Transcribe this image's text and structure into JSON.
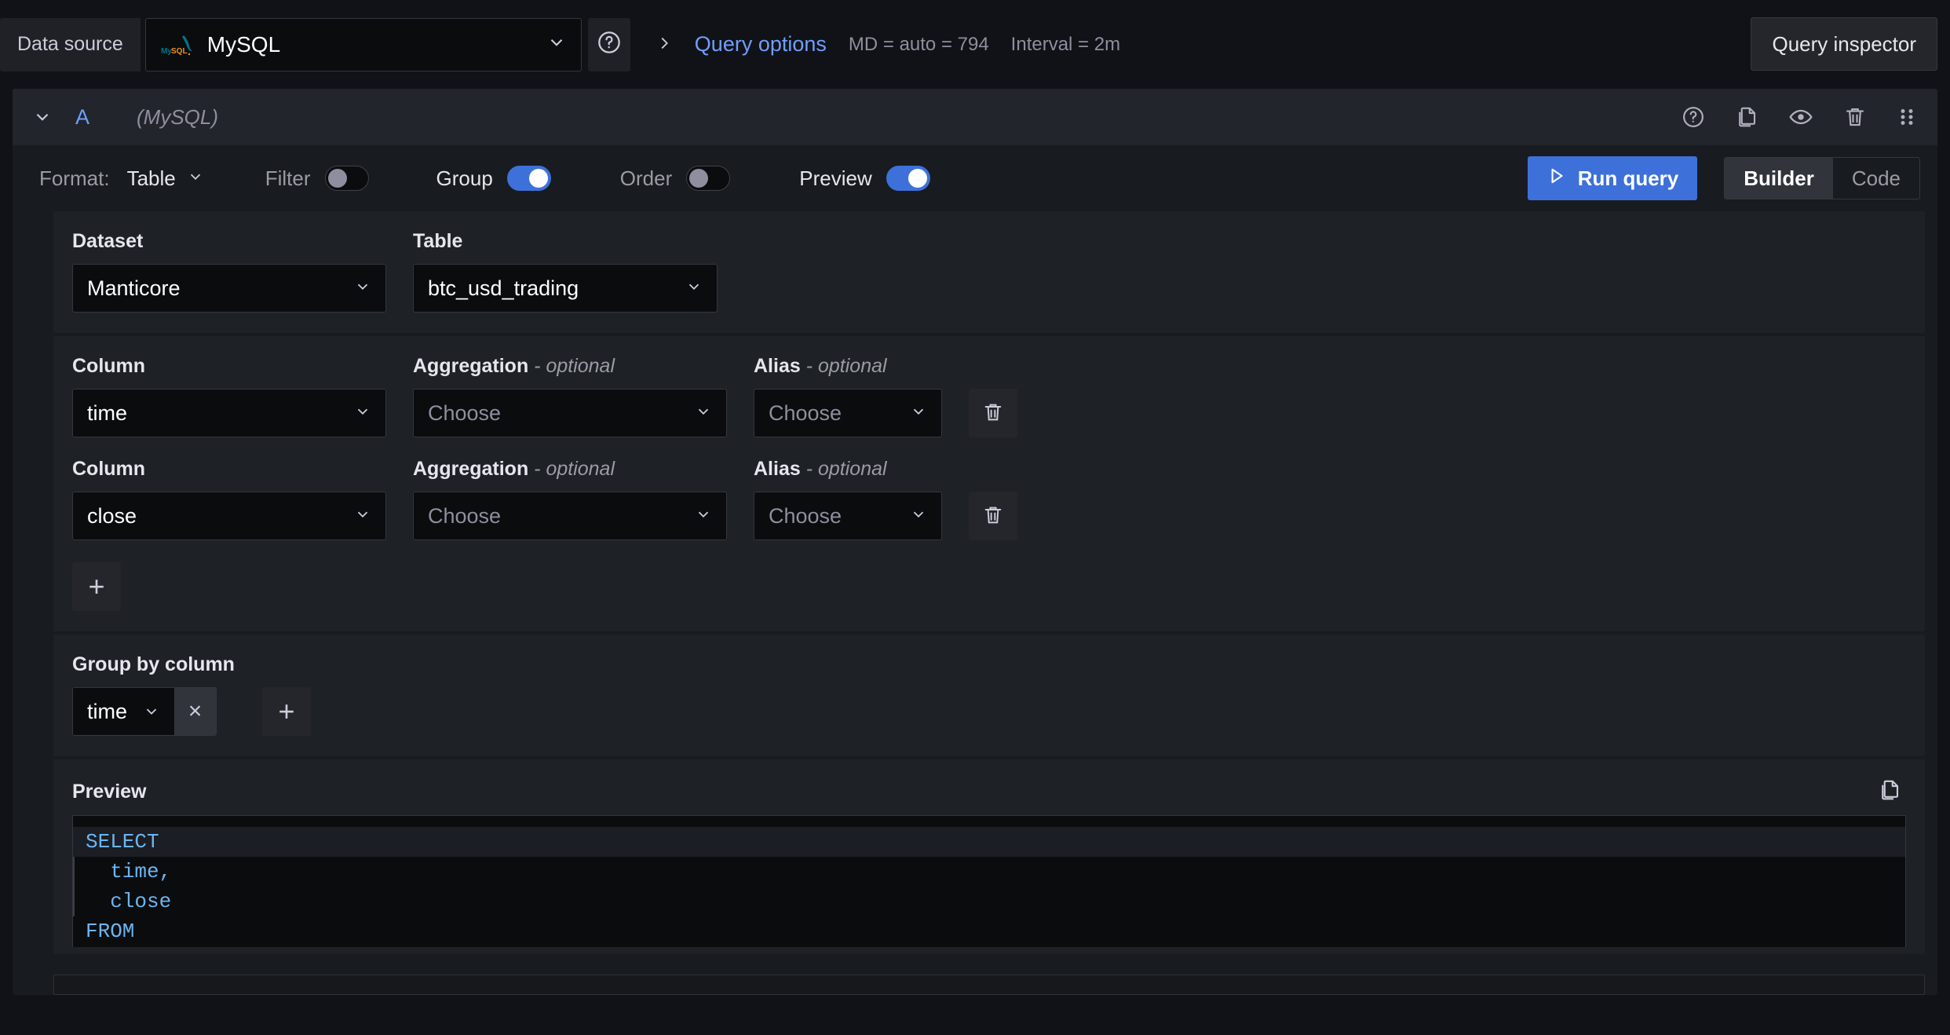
{
  "topbar": {
    "data_source_label": "Data source",
    "data_source_value": "MySQL",
    "data_source_logo": "mysql-logo-icon",
    "help_icon": "help-circle-icon",
    "query_options": {
      "expand_icon": "chevron-right-icon",
      "title": "Query options",
      "max_data_points": "MD = auto = 794",
      "interval": "Interval = 2m"
    },
    "query_inspector_label": "Query inspector"
  },
  "query_row": {
    "collapse_icon": "chevron-down-icon",
    "ref_id": "A",
    "datasource_name": "(MySQL)",
    "actions": [
      {
        "name": "help-circle-icon"
      },
      {
        "name": "copy-icon"
      },
      {
        "name": "eye-icon"
      },
      {
        "name": "trash-icon"
      },
      {
        "name": "drag-handle-icon"
      }
    ]
  },
  "toolbar": {
    "format_label": "Format:",
    "format_value": "Table",
    "toggles": [
      {
        "label": "Filter",
        "on": false
      },
      {
        "label": "Group",
        "on": true
      },
      {
        "label": "Order",
        "on": false
      },
      {
        "label": "Preview",
        "on": true
      }
    ],
    "run_query_label": "Run query",
    "run_icon": "play-icon",
    "mode_builder": "Builder",
    "mode_code": "Code",
    "active_mode": "Builder"
  },
  "dataset_section": {
    "dataset_label": "Dataset",
    "dataset_value": "Manticore",
    "table_label": "Table",
    "table_value": "btc_usd_trading"
  },
  "columns_section": {
    "column_label": "Column",
    "aggregation_label": "Aggregation",
    "aggregation_optional": "- optional",
    "alias_label": "Alias",
    "alias_optional": "- optional",
    "choose_placeholder": "Choose",
    "rows": [
      {
        "column": "time",
        "aggregation": "Choose",
        "alias": "Choose",
        "delete_icon": "trash-icon"
      },
      {
        "column": "close",
        "aggregation": "Choose",
        "alias": "Choose",
        "delete_icon": "trash-icon"
      }
    ],
    "add_label": "+"
  },
  "group_by_section": {
    "label": "Group by column",
    "chips": [
      {
        "value": "time",
        "remove_label": "×"
      }
    ],
    "add_label": "+"
  },
  "preview_section": {
    "label": "Preview",
    "copy_icon": "copy-icon",
    "sql_lines": [
      {
        "text": "SELECT",
        "indent": false,
        "current": true
      },
      {
        "text": "  time,",
        "indent": true,
        "current": false
      },
      {
        "text": "  close",
        "indent": true,
        "current": false
      },
      {
        "text": "FROM",
        "indent": false,
        "current": false
      }
    ]
  },
  "colors": {
    "accent_blue": "#3d71d9",
    "link_blue": "#6e9fff",
    "sql_blue": "#6cb5f0",
    "page_bg": "#111217",
    "panel_bg": "#181b1f",
    "section_bg": "#1e2126",
    "input_bg": "#0b0c0e"
  }
}
